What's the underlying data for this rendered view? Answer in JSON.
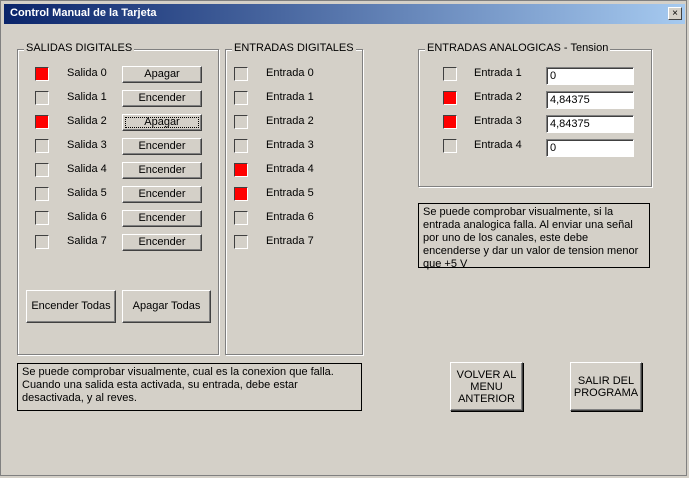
{
  "window": {
    "title": "Control Manual de la Tarjeta",
    "close_glyph": "×"
  },
  "salidas": {
    "label": "SALIDAS DIGITALES",
    "items": [
      {
        "label": "Salida 0",
        "on": true,
        "button": "Apagar"
      },
      {
        "label": "Salida 1",
        "on": false,
        "button": "Encender"
      },
      {
        "label": "Salida 2",
        "on": true,
        "button": "Apagar"
      },
      {
        "label": "Salida 3",
        "on": false,
        "button": "Encender"
      },
      {
        "label": "Salida 4",
        "on": false,
        "button": "Encender"
      },
      {
        "label": "Salida 5",
        "on": false,
        "button": "Encender"
      },
      {
        "label": "Salida 6",
        "on": false,
        "button": "Encender"
      },
      {
        "label": "Salida 7",
        "on": false,
        "button": "Encender"
      }
    ],
    "encender_todas": "Encender Todas",
    "apagar_todas": "Apagar Todas"
  },
  "entradas": {
    "label": "ENTRADAS DIGITALES",
    "items": [
      {
        "label": "Entrada 0",
        "on": false
      },
      {
        "label": "Entrada 1",
        "on": false
      },
      {
        "label": "Entrada 2",
        "on": false
      },
      {
        "label": "Entrada 3",
        "on": false
      },
      {
        "label": "Entrada 4",
        "on": true
      },
      {
        "label": "Entrada 5",
        "on": true
      },
      {
        "label": "Entrada 6",
        "on": false
      },
      {
        "label": "Entrada 7",
        "on": false
      }
    ]
  },
  "analogicas": {
    "label": "ENTRADAS ANALOGICAS - Tension",
    "items": [
      {
        "label": "Entrada 1",
        "on": false,
        "value": "0"
      },
      {
        "label": "Entrada 2",
        "on": true,
        "value": "4,84375"
      },
      {
        "label": "Entrada 3",
        "on": true,
        "value": "4,84375"
      },
      {
        "label": "Entrada 4",
        "on": false,
        "value": "0"
      }
    ]
  },
  "note_analog": "Se puede comprobar visualmente, si la entrada analogica falla. Al enviar una señal por uno de los canales, este debe encenderse y dar un valor de tension menor que +5 V",
  "note_digital": "Se puede comprobar visualmente, cual es la conexion que falla. Cuando una salida esta activada, su entrada, debe estar desactivada, y al reves.",
  "volver_button": "VOLVER AL\nMENU\nANTERIOR",
  "salir_button": "SALIR DEL\nPROGRAMA",
  "colors": {
    "on": "#ff0000",
    "face": "#d4d0c8",
    "title_start": "#0a246a",
    "title_end": "#a6caf0"
  }
}
